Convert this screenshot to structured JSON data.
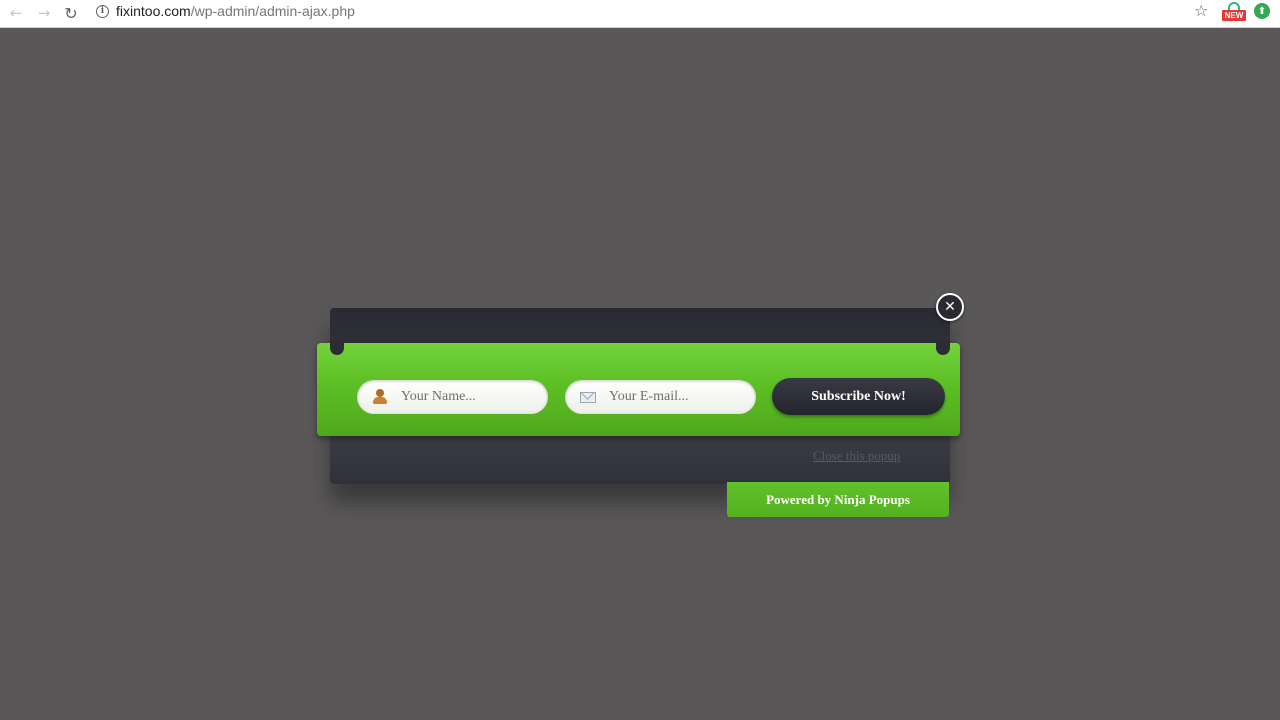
{
  "browser": {
    "back_glyph": "←",
    "forward_glyph": "→",
    "reload_glyph": "↻",
    "url_host": "fixintoo.com",
    "url_path": "/wp-admin/admin-ajax.php",
    "star_glyph": "☆",
    "extension_badge": "NEW",
    "extension_glyph": "⬆"
  },
  "popup": {
    "close_glyph": "✕",
    "name_placeholder": "Your Name...",
    "email_placeholder": "Your E-mail...",
    "subscribe_label": "Subscribe Now!",
    "close_link_label": "Close this popup",
    "powered_by": "Powered by Ninja Popups"
  },
  "colors": {
    "page_background": "#595758",
    "popup_green": "#5cbf24",
    "popup_dark": "#2a2a33"
  }
}
